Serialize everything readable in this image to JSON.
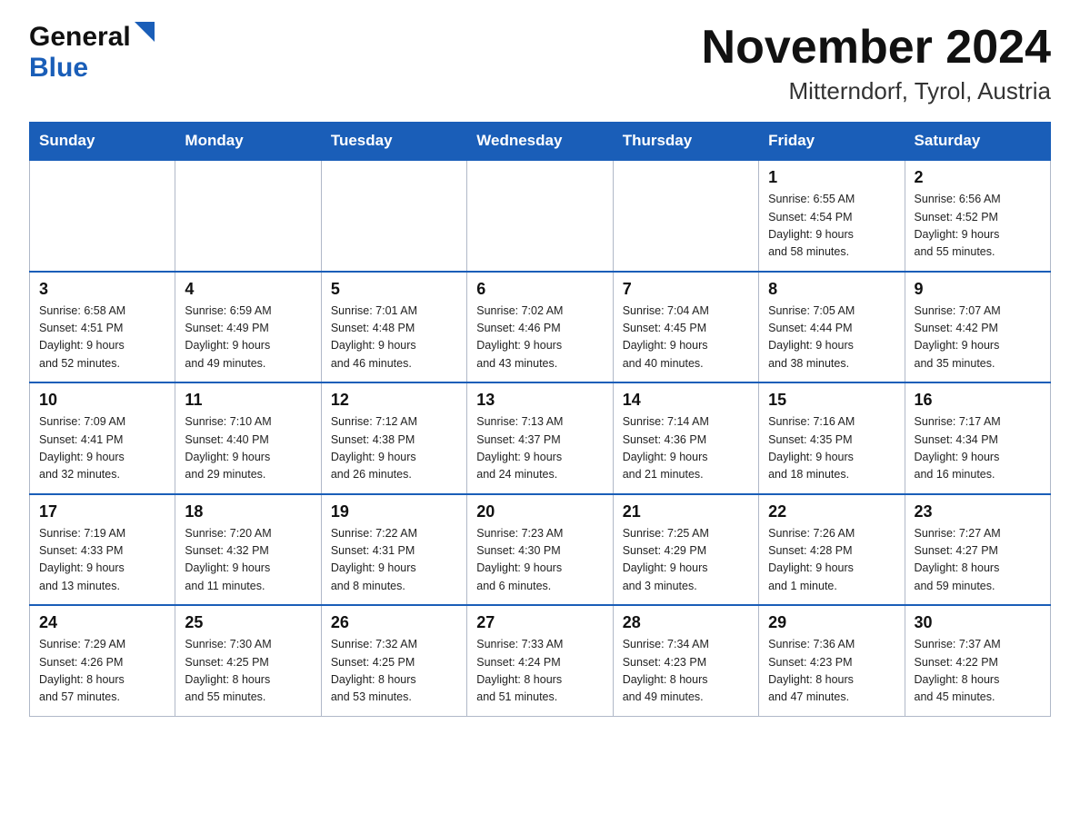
{
  "logo": {
    "general": "General",
    "blue": "Blue"
  },
  "title": "November 2024",
  "subtitle": "Mitterndorf, Tyrol, Austria",
  "weekdays": [
    "Sunday",
    "Monday",
    "Tuesday",
    "Wednesday",
    "Thursday",
    "Friday",
    "Saturday"
  ],
  "weeks": [
    [
      {
        "day": "",
        "info": ""
      },
      {
        "day": "",
        "info": ""
      },
      {
        "day": "",
        "info": ""
      },
      {
        "day": "",
        "info": ""
      },
      {
        "day": "",
        "info": ""
      },
      {
        "day": "1",
        "info": "Sunrise: 6:55 AM\nSunset: 4:54 PM\nDaylight: 9 hours\nand 58 minutes."
      },
      {
        "day": "2",
        "info": "Sunrise: 6:56 AM\nSunset: 4:52 PM\nDaylight: 9 hours\nand 55 minutes."
      }
    ],
    [
      {
        "day": "3",
        "info": "Sunrise: 6:58 AM\nSunset: 4:51 PM\nDaylight: 9 hours\nand 52 minutes."
      },
      {
        "day": "4",
        "info": "Sunrise: 6:59 AM\nSunset: 4:49 PM\nDaylight: 9 hours\nand 49 minutes."
      },
      {
        "day": "5",
        "info": "Sunrise: 7:01 AM\nSunset: 4:48 PM\nDaylight: 9 hours\nand 46 minutes."
      },
      {
        "day": "6",
        "info": "Sunrise: 7:02 AM\nSunset: 4:46 PM\nDaylight: 9 hours\nand 43 minutes."
      },
      {
        "day": "7",
        "info": "Sunrise: 7:04 AM\nSunset: 4:45 PM\nDaylight: 9 hours\nand 40 minutes."
      },
      {
        "day": "8",
        "info": "Sunrise: 7:05 AM\nSunset: 4:44 PM\nDaylight: 9 hours\nand 38 minutes."
      },
      {
        "day": "9",
        "info": "Sunrise: 7:07 AM\nSunset: 4:42 PM\nDaylight: 9 hours\nand 35 minutes."
      }
    ],
    [
      {
        "day": "10",
        "info": "Sunrise: 7:09 AM\nSunset: 4:41 PM\nDaylight: 9 hours\nand 32 minutes."
      },
      {
        "day": "11",
        "info": "Sunrise: 7:10 AM\nSunset: 4:40 PM\nDaylight: 9 hours\nand 29 minutes."
      },
      {
        "day": "12",
        "info": "Sunrise: 7:12 AM\nSunset: 4:38 PM\nDaylight: 9 hours\nand 26 minutes."
      },
      {
        "day": "13",
        "info": "Sunrise: 7:13 AM\nSunset: 4:37 PM\nDaylight: 9 hours\nand 24 minutes."
      },
      {
        "day": "14",
        "info": "Sunrise: 7:14 AM\nSunset: 4:36 PM\nDaylight: 9 hours\nand 21 minutes."
      },
      {
        "day": "15",
        "info": "Sunrise: 7:16 AM\nSunset: 4:35 PM\nDaylight: 9 hours\nand 18 minutes."
      },
      {
        "day": "16",
        "info": "Sunrise: 7:17 AM\nSunset: 4:34 PM\nDaylight: 9 hours\nand 16 minutes."
      }
    ],
    [
      {
        "day": "17",
        "info": "Sunrise: 7:19 AM\nSunset: 4:33 PM\nDaylight: 9 hours\nand 13 minutes."
      },
      {
        "day": "18",
        "info": "Sunrise: 7:20 AM\nSunset: 4:32 PM\nDaylight: 9 hours\nand 11 minutes."
      },
      {
        "day": "19",
        "info": "Sunrise: 7:22 AM\nSunset: 4:31 PM\nDaylight: 9 hours\nand 8 minutes."
      },
      {
        "day": "20",
        "info": "Sunrise: 7:23 AM\nSunset: 4:30 PM\nDaylight: 9 hours\nand 6 minutes."
      },
      {
        "day": "21",
        "info": "Sunrise: 7:25 AM\nSunset: 4:29 PM\nDaylight: 9 hours\nand 3 minutes."
      },
      {
        "day": "22",
        "info": "Sunrise: 7:26 AM\nSunset: 4:28 PM\nDaylight: 9 hours\nand 1 minute."
      },
      {
        "day": "23",
        "info": "Sunrise: 7:27 AM\nSunset: 4:27 PM\nDaylight: 8 hours\nand 59 minutes."
      }
    ],
    [
      {
        "day": "24",
        "info": "Sunrise: 7:29 AM\nSunset: 4:26 PM\nDaylight: 8 hours\nand 57 minutes."
      },
      {
        "day": "25",
        "info": "Sunrise: 7:30 AM\nSunset: 4:25 PM\nDaylight: 8 hours\nand 55 minutes."
      },
      {
        "day": "26",
        "info": "Sunrise: 7:32 AM\nSunset: 4:25 PM\nDaylight: 8 hours\nand 53 minutes."
      },
      {
        "day": "27",
        "info": "Sunrise: 7:33 AM\nSunset: 4:24 PM\nDaylight: 8 hours\nand 51 minutes."
      },
      {
        "day": "28",
        "info": "Sunrise: 7:34 AM\nSunset: 4:23 PM\nDaylight: 8 hours\nand 49 minutes."
      },
      {
        "day": "29",
        "info": "Sunrise: 7:36 AM\nSunset: 4:23 PM\nDaylight: 8 hours\nand 47 minutes."
      },
      {
        "day": "30",
        "info": "Sunrise: 7:37 AM\nSunset: 4:22 PM\nDaylight: 8 hours\nand 45 minutes."
      }
    ]
  ]
}
